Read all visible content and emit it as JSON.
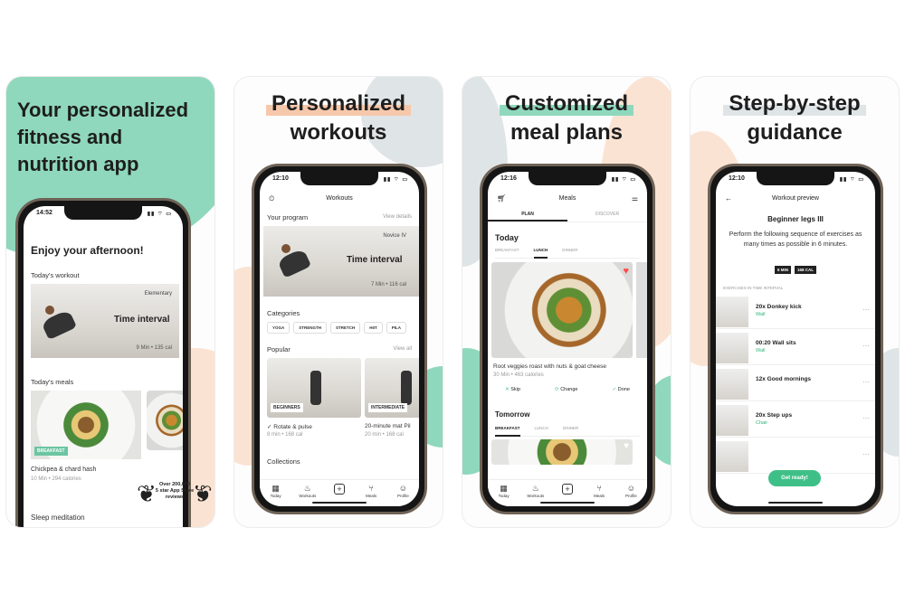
{
  "colors": {
    "mint": "#8fd8bd",
    "mint_strong": "#6cc5a2",
    "peach": "#fbe3d3",
    "peach_deep": "#f6c8ab",
    "grey": "#dfe4e6",
    "green": "#3ebf87",
    "heart": "#ff4d4d"
  },
  "panel1": {
    "heading": "Your personalized fitness and nutrition app",
    "heading_lines": [
      "Your personalized",
      "fitness and",
      "nutrition app"
    ],
    "time": "14:52",
    "greeting": "Enjoy your afternoon!",
    "todays_workout": "Today's workout",
    "workout_level": "Elementary",
    "workout_title": "Time interval",
    "workout_meta": "9 Min • 135 cal",
    "todays_meals": "Today's meals",
    "meal_tag": "BREAKFAST",
    "meal_title": "Chickpea & chard hash",
    "meal_meta": "10 Min • 294 calories",
    "badge_lines": [
      "Over 200,000",
      "5 star App Store",
      "reviews"
    ],
    "sleep": "Sleep meditation"
  },
  "panel2": {
    "heading_lines": [
      "Personalized",
      "workouts"
    ],
    "time": "12:10",
    "title": "Workouts",
    "your_program": "Your program",
    "view_details": "View details",
    "program_level": "Novice IV",
    "program_title": "Time interval",
    "program_meta": "7 Min • 116 cal",
    "categories_label": "Categories",
    "categories": [
      "YOGA",
      "STRENGTH",
      "STRETCH",
      "HIIT",
      "PILA"
    ],
    "popular_label": "Popular",
    "view_all": "View all",
    "popular": [
      {
        "tag": "BEGINNERS",
        "title": "✓ Rotate & pulse",
        "meta": "8 min • 168 cal"
      },
      {
        "tag": "INTERMEDIATE",
        "title": "20-minute mat Pil",
        "meta": "20 min • 168 cal"
      }
    ],
    "collections": "Collections",
    "tabs": [
      "Today",
      "Workouts",
      "",
      "Meals",
      "Profile"
    ],
    "tab_icons": [
      "calendar-icon",
      "flame-icon",
      "plus-icon",
      "utensils-icon",
      "profile-icon"
    ]
  },
  "panel3": {
    "heading_lines": [
      "Customized",
      "meal plans"
    ],
    "time": "12:16",
    "title": "Meals",
    "subtabs": [
      "PLAN",
      "DISCOVER"
    ],
    "today": "Today",
    "meal_tabs": [
      "BREAKFAST",
      "LUNCH",
      "DINNER"
    ],
    "dish_title": "Root veggies roast with nuts & goat cheese",
    "dish_meta": "30 Min • 463 calories",
    "actions": [
      "Skip",
      "Change",
      "Done"
    ],
    "tomorrow": "Tomorrow",
    "meal_tabs2": [
      "BREAKFAST",
      "LUNCH",
      "DINNER"
    ],
    "tabs": [
      "Today",
      "Workouts",
      "",
      "Meals",
      "Profile"
    ],
    "tab_icons": [
      "calendar-icon",
      "flame-icon",
      "plus-icon",
      "utensils-icon",
      "profile-icon"
    ]
  },
  "panel4": {
    "heading_lines": [
      "Step-by-step",
      "guidance"
    ],
    "time": "12:10",
    "title": "Workout preview",
    "workout_name": "Beginner legs III",
    "description": "Perform the following sequence of exercises as many times as possible in 6 minutes.",
    "pills": [
      "6 MIN",
      "168 CAL"
    ],
    "section_label": "EXERCISES IN TIME INTERVAL",
    "exercises": [
      {
        "title": "20x Donkey kick",
        "sub": "Wall"
      },
      {
        "title": "00:20 Wall sits",
        "sub": "Wall"
      },
      {
        "title": "12x Good mornings",
        "sub": ""
      },
      {
        "title": "20x Step ups",
        "sub": "Chair"
      },
      {
        "title": "",
        "sub": ""
      }
    ],
    "cta": "Get ready!"
  }
}
